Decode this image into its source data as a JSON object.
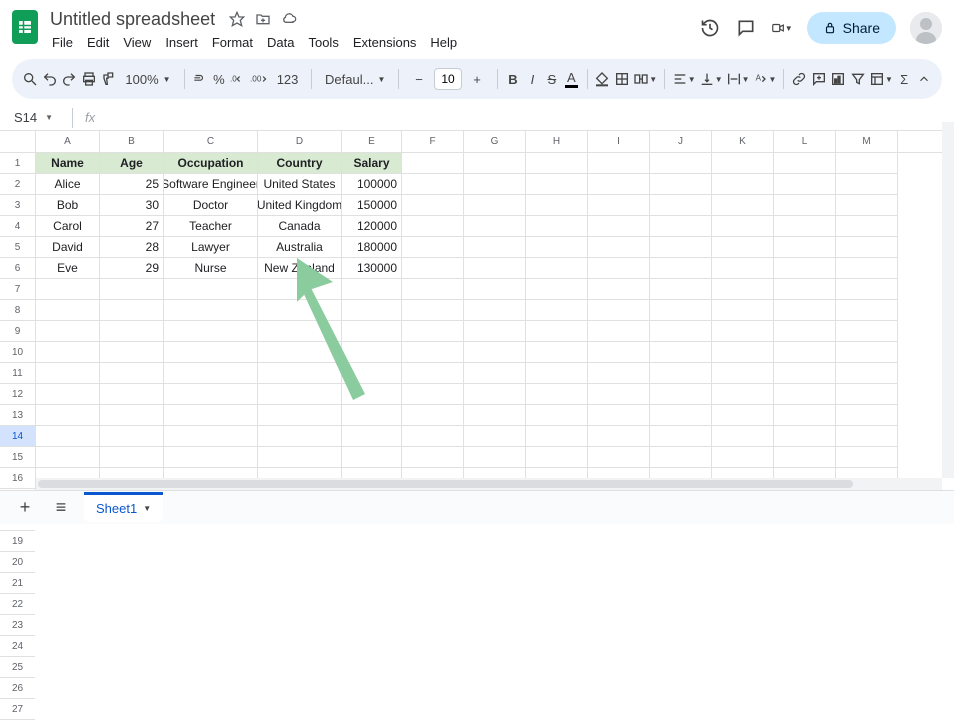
{
  "document": {
    "title": "Untitled spreadsheet"
  },
  "menus": [
    "File",
    "Edit",
    "View",
    "Insert",
    "Format",
    "Data",
    "Tools",
    "Extensions",
    "Help"
  ],
  "share": {
    "label": "Share"
  },
  "toolbar": {
    "zoom": "100%",
    "font": "Defaul...",
    "fontSize": "10",
    "format_123": "123"
  },
  "nameBox": {
    "ref": "S14",
    "formula": ""
  },
  "columns": [
    "A",
    "B",
    "C",
    "D",
    "E",
    "F",
    "G",
    "H",
    "I",
    "J",
    "K",
    "L",
    "M"
  ],
  "rowCount": 27,
  "selectedRow": 14,
  "table": {
    "headers": [
      "Name",
      "Age",
      "Occupation",
      "Country",
      "Salary"
    ],
    "rows": [
      {
        "name": "Alice",
        "age": "25",
        "occupation": "Software Engineer",
        "country": "United States",
        "salary": "100000"
      },
      {
        "name": "Bob",
        "age": "30",
        "occupation": "Doctor",
        "country": "United Kingdom",
        "salary": "150000"
      },
      {
        "name": "Carol",
        "age": "27",
        "occupation": "Teacher",
        "country": "Canada",
        "salary": "120000"
      },
      {
        "name": "David",
        "age": "28",
        "occupation": "Lawyer",
        "country": "Australia",
        "salary": "180000"
      },
      {
        "name": "Eve",
        "age": "29",
        "occupation": "Nurse",
        "country": "New Zealand",
        "salary": "130000"
      }
    ]
  },
  "sheetTab": {
    "name": "Sheet1"
  }
}
